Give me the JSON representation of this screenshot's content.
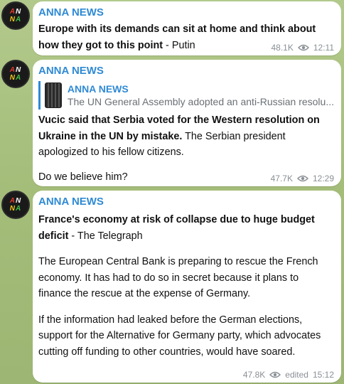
{
  "messages": [
    {
      "sender": "ANNA NEWS",
      "bold": "Europe with its demands can sit at home and think about how they got to this point",
      "rest": " - Putin",
      "views": "48.1K",
      "time": "12:11"
    },
    {
      "sender": "ANNA NEWS",
      "reply": {
        "sender": "ANNA NEWS",
        "text": "The UN General Assembly adopted an anti-Russian resolu..."
      },
      "bold": "Vucic said that Serbia voted for the Western resolution on Ukraine in the UN by mistake.",
      "rest": " The Serbian president apologized to his fellow citizens.",
      "extra": "Do we believe him?",
      "views": "47.7K",
      "time": "12:29"
    },
    {
      "sender": "ANNA NEWS",
      "bold": "France's economy at risk of collapse due to huge budget deficit",
      "rest": " - The Telegraph",
      "para2": "The European Central Bank is preparing to rescue the French economy. It has had to do so in secret because it plans to finance the rescue at the expense of Germany.",
      "para3": "If the information had leaked before the German elections, support for the Alternative for Germany party, which advocates cutting off funding to other countries, would have soared.",
      "views": "47.8K",
      "edited": "edited",
      "time": "15:12"
    }
  ],
  "avatar": {
    "l1": "A",
    "l2": "N",
    "l3": "N",
    "l4": "A"
  },
  "icons": {
    "views": "eye-icon"
  }
}
